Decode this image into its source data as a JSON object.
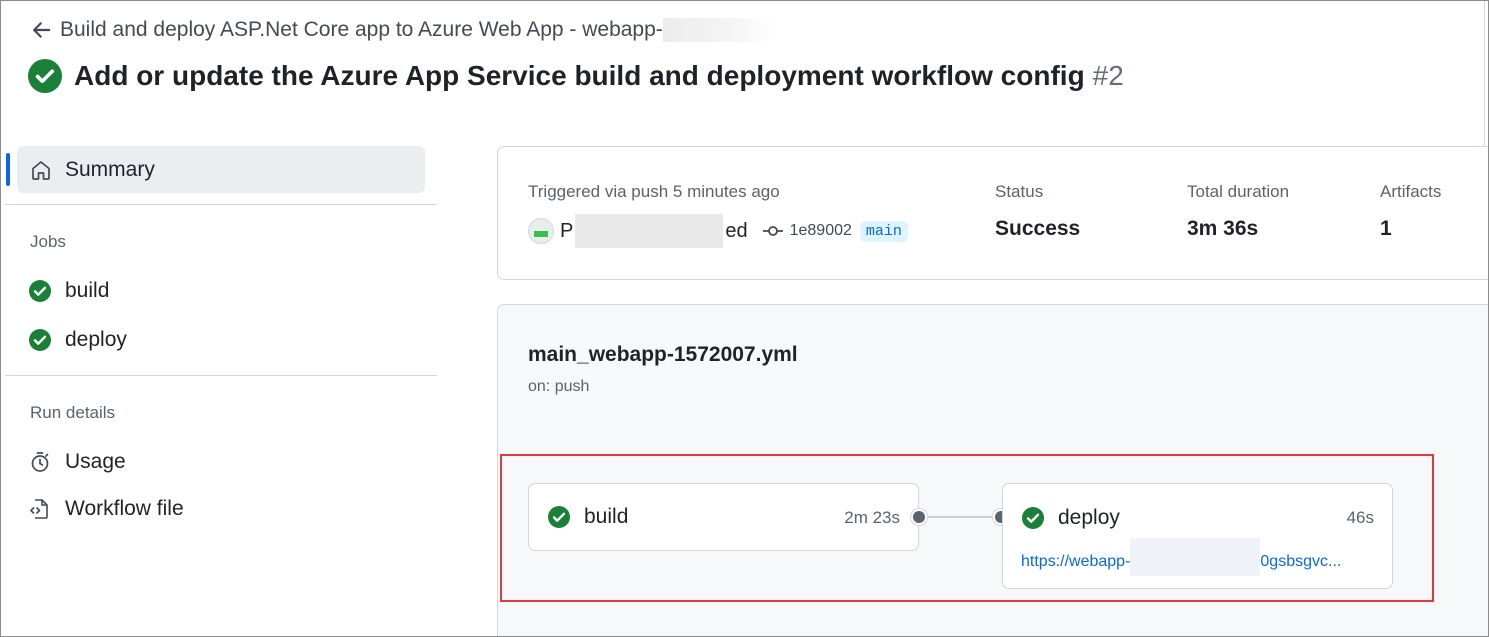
{
  "header": {
    "back_text": "Build and deploy ASP.Net Core app to Azure Web App - webapp-",
    "run_title": "Add or update the Azure App Service build and deployment workflow config",
    "run_number": "#2"
  },
  "sidebar": {
    "summary_label": "Summary",
    "jobs_heading": "Jobs",
    "jobs": [
      {
        "label": "build"
      },
      {
        "label": "deploy"
      }
    ],
    "run_details_heading": "Run details",
    "details": [
      {
        "label": "Usage"
      },
      {
        "label": "Workflow file"
      }
    ]
  },
  "summary": {
    "trigger_text": "Triggered via push 5 minutes ago",
    "actor_initial": "P",
    "actor_suffix": "ed",
    "commit_hash": "1e89002",
    "branch": "main",
    "status_label": "Status",
    "status_value": "Success",
    "duration_label": "Total duration",
    "duration_value": "3m 36s",
    "artifacts_label": "Artifacts",
    "artifacts_value": "1"
  },
  "workflow": {
    "file_name": "main_webapp-1572007.yml",
    "trigger": "on: push",
    "jobs": [
      {
        "name": "build",
        "duration": "2m 23s"
      },
      {
        "name": "deploy",
        "duration": "46s",
        "link_start": "https://webapp-",
        "link_end": "0gsbsgvc..."
      }
    ]
  },
  "colors": {
    "success": "#1a7f37",
    "accent": "#0969da",
    "highlight": "#e0393e"
  }
}
